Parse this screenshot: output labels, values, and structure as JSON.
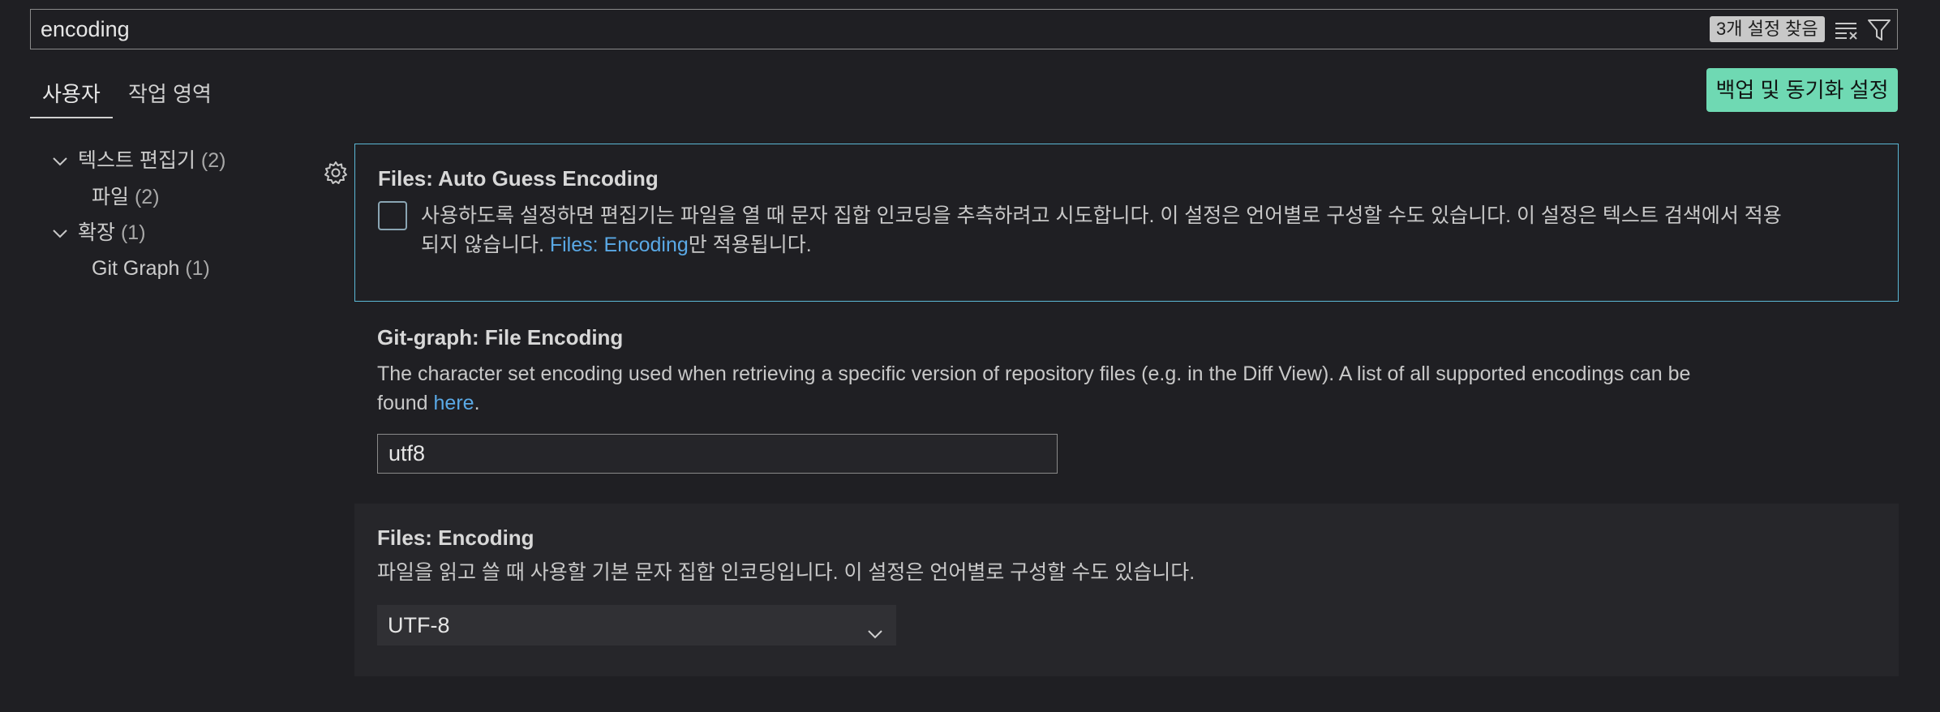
{
  "search": {
    "value": "encoding",
    "results_badge": "3개 설정 찾음"
  },
  "icons": {
    "clear_filter": "clear-filter-icon",
    "filter": "filter-icon",
    "gear": "gear-icon",
    "chevron": "chevron-down-icon"
  },
  "tabs": [
    {
      "label": "사용자",
      "active": true
    },
    {
      "label": "작업 영역",
      "active": false
    }
  ],
  "sync_button": {
    "label": "백업 및 동기화 설정"
  },
  "toc": [
    {
      "label": "텍스트 편집기",
      "count": "(2)",
      "expanded": true
    },
    {
      "label": "파일",
      "count": "(2)"
    },
    {
      "label": "확장",
      "count": "(1)",
      "expanded": true
    },
    {
      "label": "Git Graph",
      "count": "(1)"
    }
  ],
  "settings": [
    {
      "title": "Files: Auto Guess Encoding",
      "desc_line1": "사용하도록 설정하면 편집기는 파일을 열 때 문자 집합 인코딩을 추측하려고 시도합니다. 이 설정은 언어별로 구성할 수도 있습니다. 이 설정은 텍스트 검색에서 적용",
      "desc_line2_prefix": "되지 않습니다. ",
      "desc_link": "Files: Encoding",
      "desc_line2_suffix": "만 적용됩니다.",
      "checked": false
    },
    {
      "title": "Git-graph: File Encoding",
      "desc_line1": "The character set encoding used when retrieving a specific version of repository files (e.g. in the Diff View). A list of all supported encodings can be",
      "desc_line2_prefix": "found ",
      "desc_link": "here",
      "desc_line2_suffix": ".",
      "value": "utf8"
    },
    {
      "title": "Files: Encoding",
      "desc_line1": "파일을 읽고 쓸 때 사용할 기본 문자 집합 인코딩입니다. 이 설정은 언어별로 구성할 수도 있습니다.",
      "selected": "UTF-8"
    }
  ],
  "colors": {
    "accent_border": "#5bb8d6",
    "sync_button_bg": "#6fd9b3",
    "link": "#5aa9e6",
    "background": "#1f1f23"
  }
}
